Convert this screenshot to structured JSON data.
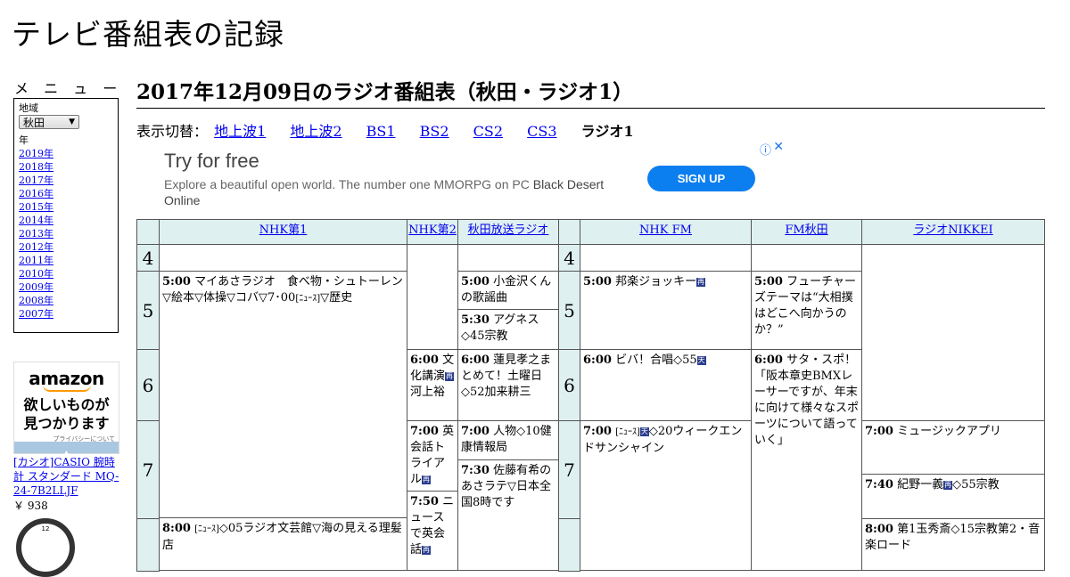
{
  "site": {
    "title": "テレビ番組表の記録"
  },
  "sidebar": {
    "menu_title": "メ ニ ュ ー",
    "region_label": "地域",
    "region_value": "秋田",
    "year_label": "年",
    "years": [
      "2019年",
      "2018年",
      "2017年",
      "2016年",
      "2015年",
      "2014年",
      "2013年",
      "2012年",
      "2011年",
      "2010年",
      "2009年",
      "2008年",
      "2007年"
    ]
  },
  "amazon_ad": {
    "logo": "amazon",
    "message_line1": "欲しいものが",
    "message_line2": "見つかります",
    "privacy": "プライバシーについて",
    "product": "[カシオ]CASIO 腕時計 スタンダード MQ-24-7B2LLJF",
    "price": "￥ 938"
  },
  "page": {
    "heading": "2017年12月09日のラジオ番組表（秋田・ラジオ1）",
    "nav_label": "表示切替：",
    "nav_links": [
      "地上波1",
      "地上波2",
      "BS1",
      "BS2",
      "CS2",
      "CS3"
    ],
    "nav_current": "ラジオ1"
  },
  "banner_ad": {
    "headline": "Try for free",
    "body": "Explore a beautiful open world. The number one MMORPG on PC",
    "body_highlight": "Black Desert Online",
    "cta": "SIGN UP",
    "choices_icon": "ⓘ",
    "close_icon": "✕"
  },
  "schedule": {
    "stations": [
      "NHK第1",
      "NHK第2",
      "秋田放送ラジオ",
      "NHK FM",
      "FM秋田",
      "ラジオNIKKEI"
    ],
    "hours": [
      "4",
      "5",
      "6",
      "7"
    ],
    "programs": {
      "nhk1_500_time": "5:00",
      "nhk1_500_title": "マイあさラジオ　食べ物・シュトーレン▽絵本▽体操▽コバ▽",
      "nhk1_500_mid": "7･00",
      "nhk1_500_news": "[ﾆｭｰｽ]",
      "nhk1_500_tail": "▽歴史",
      "nhk1_800_time": "8:00",
      "nhk1_800_news": "[ﾆｭｰｽ]",
      "nhk1_800_title": "◇05ラジオ文芸館▽海の見える理髪店",
      "nhk2_600_time": "6:00",
      "nhk2_600_title": "文化講演",
      "nhk2_600_tail": "　河上裕",
      "nhk2_700_time": "7:00",
      "nhk2_700_title": "英会話トライアル",
      "nhk2_750_time": "7:50",
      "nhk2_750_title": "ニュースで英会話",
      "abs_500_time": "5:00",
      "abs_500_title": "小金沢くんの歌謡曲",
      "abs_530_time": "5:30",
      "abs_530_title": "アグネス◇45宗教",
      "abs_600_time": "6:00",
      "abs_600_title": "蓮見孝之まとめて！土曜日◇52加来耕三",
      "abs_700_time": "7:00",
      "abs_700_title": "人物◇10健康情報局",
      "abs_730_time": "7:30",
      "abs_730_title": "佐藤有希のあさラテ▽日本全国8時です",
      "fm_500_time": "5:00",
      "fm_500_title": "邦楽ジョッキー",
      "fm_600_time": "6:00",
      "fm_600_title": "ビバ！合唱◇55",
      "fm_700_time": "7:00",
      "fm_700_news": "[ﾆｭｰｽ]",
      "fm_700_title": "◇20ウィークエンドサンシャイン",
      "fma_500_time": "5:00",
      "fma_500_title": "フューチャーズテーマは“大相撲はどこへ向かうのか？”",
      "fma_600_time": "6:00",
      "fma_600_title": "サタ・スポ！「阪本章史BMXレーサーですが、年末に向けて様々なスポーツについて語っていく」",
      "nikkei_700_time": "7:00",
      "nikkei_700_title": "ミュージックアプリ",
      "nikkei_740_time": "7:40",
      "nikkei_740_title": "紀野一義",
      "nikkei_740_tail": "◇55宗教",
      "nikkei_800_time": "8:00",
      "nikkei_800_title": "第1玉秀斎◇15宗教第2・音楽ロード"
    },
    "icons": {
      "reair": "再",
      "weather": "天"
    }
  }
}
